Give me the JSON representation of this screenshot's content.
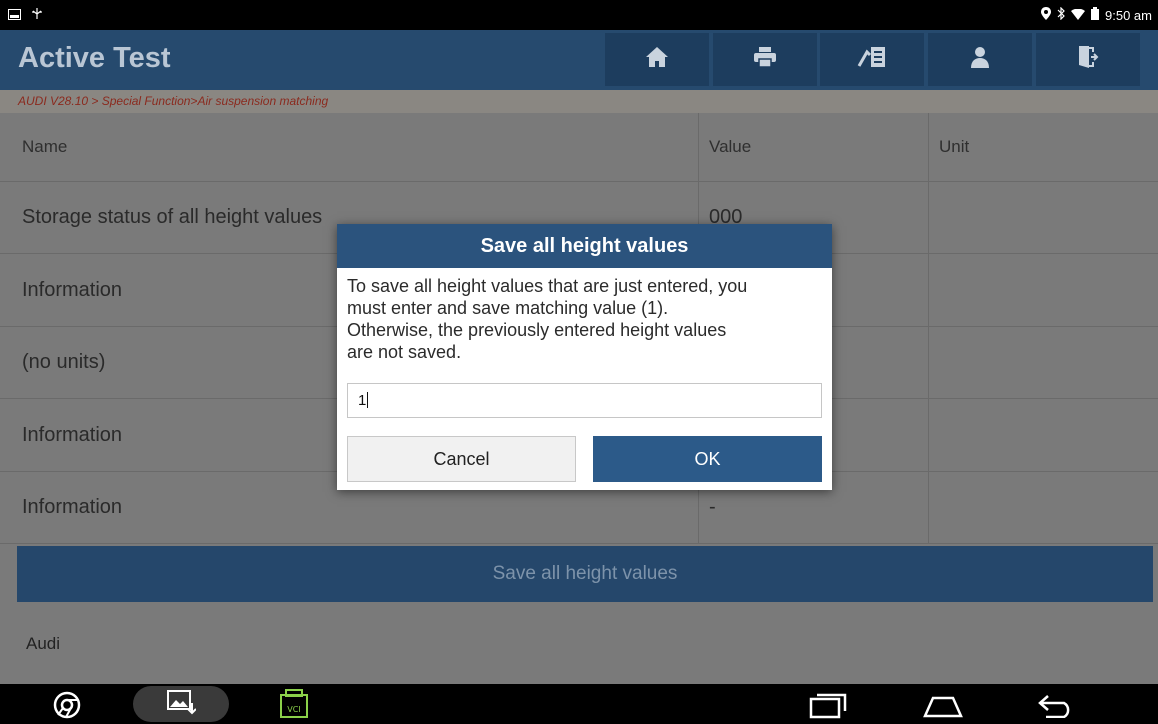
{
  "status": {
    "time": "9:50 am"
  },
  "header": {
    "title": "Active Test"
  },
  "nav_icons": [
    "home-icon",
    "print-icon",
    "report-icon",
    "user-icon",
    "exit-icon"
  ],
  "breadcrumb": "AUDI V28.10 > Special Function>Air suspension matching",
  "table": {
    "columns": [
      "Name",
      "Value",
      "Unit"
    ],
    "rows": [
      {
        "name": "Storage status of all height values",
        "value": "000",
        "unit": ""
      },
      {
        "name": "Information",
        "value": "",
        "unit": ""
      },
      {
        "name": "(no units)",
        "value": "",
        "unit": ""
      },
      {
        "name": "Information",
        "value": "",
        "unit": ""
      },
      {
        "name": "Information",
        "value": "-",
        "unit": ""
      }
    ]
  },
  "action_button": "Save all height values",
  "footer_label": "Audi",
  "dialog": {
    "title": "Save all height values",
    "message_lines": [
      "To save all height values that are just entered, you",
      "must enter and save matching value (1).",
      "Otherwise, the previously entered height values",
      "are not saved."
    ],
    "input_value": "1",
    "cancel_label": "Cancel",
    "ok_label": "OK"
  },
  "colors": {
    "title_bar": "#264a6e",
    "dim_overlay_bg": "#7a7a7a",
    "dialog_title": "#2b537d",
    "ok_button": "#2c5a89"
  }
}
